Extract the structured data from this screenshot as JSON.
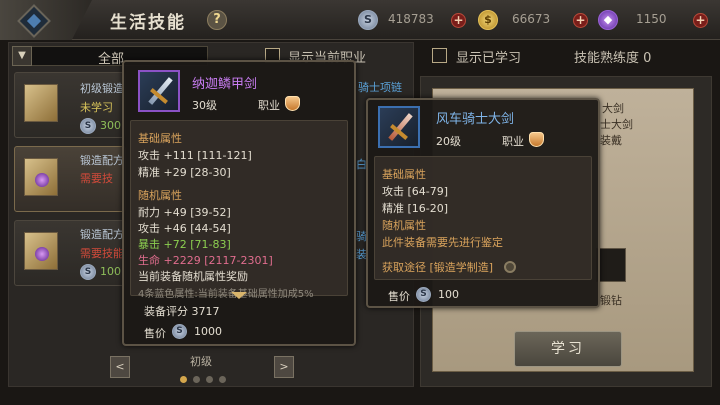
{
  "header": {
    "title": "生活技能",
    "help": "?",
    "currencies": [
      {
        "icon": "silver-coin-icon",
        "glyph": "S",
        "value": "418783"
      },
      {
        "icon": "gold-coin-icon",
        "glyph": "$",
        "value": "66673"
      },
      {
        "icon": "purple-gem-icon",
        "glyph": "◆",
        "value": "1150"
      }
    ],
    "plus": "+"
  },
  "filters": {
    "category": "全部",
    "show_current_job": "显示当前职业",
    "show_learned": "显示已学习",
    "proficiency": "技能熟练度 0"
  },
  "recipes": [
    {
      "name": "初级锻造",
      "status": "未学习",
      "cost": "300"
    },
    {
      "name": "锻造配方",
      "status": "需要技",
      "cost": ""
    },
    {
      "name": "锻造配方",
      "status": "需要技能",
      "cost": "100"
    }
  ],
  "partial_labels": {
    "skill_chain": "骑士项链",
    "r1": "白",
    "r2": "骑",
    "r3": "装"
  },
  "pager": {
    "level_label": "初级",
    "prev": "<",
    "next": ">"
  },
  "right_panel": {
    "line1": "大剑",
    "line2": "士大剑",
    "line3": "装戴",
    "slot_label": "锻钻",
    "learn_button": "学习"
  },
  "tooltip_main": {
    "name": "纳迦鳞甲剑",
    "level": "30级",
    "job_label": "职业",
    "basic_header": "基础属性",
    "basic": [
      "攻击 +111 [111-121]",
      "精准 +29 [28-30]"
    ],
    "random_header": "随机属性",
    "random": [
      {
        "text": "耐力 +49 [39-52]",
        "color": "normal"
      },
      {
        "text": "攻击 +46 [44-54]",
        "color": "normal"
      },
      {
        "text": "暴击 +72 [71-83]",
        "color": "green"
      },
      {
        "text": "生命 +2229 [2117-2301]",
        "color": "pink"
      }
    ],
    "bonus": "当前装备随机属性奖励",
    "bonus_note": "4条蓝色属性:当前装备基础属性加成5%",
    "score": "装备评分  3717",
    "price_label": "售价",
    "price": "1000"
  },
  "tooltip_compare": {
    "name": "风车骑士大剑",
    "level": "20级",
    "job_label": "职业",
    "basic_header": "基础属性",
    "basic": [
      "攻击  [64-79]",
      "精准  [16-20]"
    ],
    "random_header": "随机属性",
    "random_note": "此件装备需要先进行鉴定",
    "source": "获取途径 [锻造学制造]",
    "price_label": "售价",
    "price": "100"
  },
  "colors": {
    "accent_purple": "#c77cf0",
    "name_blue": "#7fb4e8",
    "header_gold": "#d9a35c",
    "green": "#8ccf50",
    "pink": "#e06d8e"
  }
}
